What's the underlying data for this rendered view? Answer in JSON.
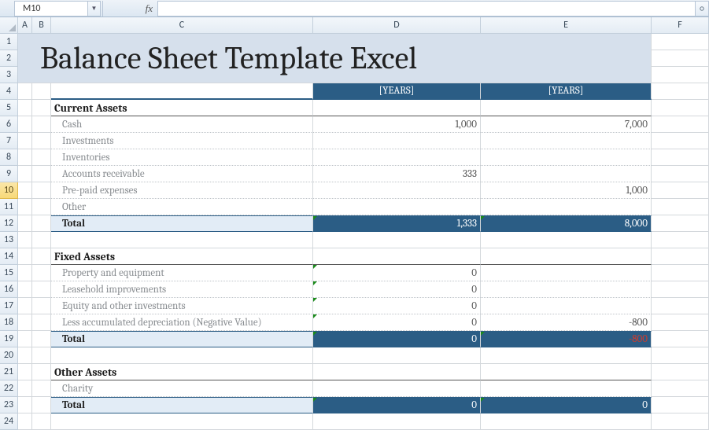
{
  "formula_bar": {
    "cell_ref": "M10",
    "fx_label": "fx",
    "formula": ""
  },
  "columns": [
    "A",
    "B",
    "C",
    "D",
    "E",
    "F"
  ],
  "title": "Balance Sheet Template Excel",
  "years_header": {
    "label_c": "",
    "col_d": "[YEARS]",
    "col_e": "[YEARS]"
  },
  "sections": {
    "current_assets": {
      "heading": "Current Assets",
      "items": [
        {
          "label": "Cash",
          "d": "1,000",
          "e": "7,000"
        },
        {
          "label": "Investments",
          "d": "",
          "e": ""
        },
        {
          "label": "Inventories",
          "d": "",
          "e": ""
        },
        {
          "label": "Accounts receivable",
          "d": "333",
          "e": ""
        },
        {
          "label": "Pre-paid expenses",
          "d": "",
          "e": "1,000"
        },
        {
          "label": "Other",
          "d": "",
          "e": ""
        }
      ],
      "total": {
        "label": "Total",
        "d": "1,333",
        "e": "8,000"
      }
    },
    "fixed_assets": {
      "heading": "Fixed Assets",
      "items": [
        {
          "label": "Property and equipment",
          "d": "0",
          "e": ""
        },
        {
          "label": "Leasehold improvements",
          "d": "0",
          "e": ""
        },
        {
          "label": "Equity and other investments",
          "d": "0",
          "e": ""
        },
        {
          "label": "Less accumulated depreciation (Negative Value)",
          "d": "0",
          "e": "-800"
        }
      ],
      "total": {
        "label": "Total",
        "d": "0",
        "e": "-800"
      }
    },
    "other_assets": {
      "heading": "Other Assets",
      "items": [
        {
          "label": "Charity",
          "d": "",
          "e": ""
        }
      ],
      "total": {
        "label": "Total",
        "d": "0",
        "e": "0"
      }
    }
  },
  "chart_data": {
    "type": "table",
    "title": "Balance Sheet Template Excel",
    "columns": [
      "[YEARS]",
      "[YEARS]"
    ],
    "rows": [
      {
        "section": "Current Assets",
        "item": "Cash",
        "values": [
          1000,
          7000
        ]
      },
      {
        "section": "Current Assets",
        "item": "Investments",
        "values": [
          null,
          null
        ]
      },
      {
        "section": "Current Assets",
        "item": "Inventories",
        "values": [
          null,
          null
        ]
      },
      {
        "section": "Current Assets",
        "item": "Accounts receivable",
        "values": [
          333,
          null
        ]
      },
      {
        "section": "Current Assets",
        "item": "Pre-paid expenses",
        "values": [
          null,
          1000
        ]
      },
      {
        "section": "Current Assets",
        "item": "Other",
        "values": [
          null,
          null
        ]
      },
      {
        "section": "Current Assets",
        "item": "Total",
        "values": [
          1333,
          8000
        ]
      },
      {
        "section": "Fixed Assets",
        "item": "Property and equipment",
        "values": [
          0,
          null
        ]
      },
      {
        "section": "Fixed Assets",
        "item": "Leasehold improvements",
        "values": [
          0,
          null
        ]
      },
      {
        "section": "Fixed Assets",
        "item": "Equity and other investments",
        "values": [
          0,
          null
        ]
      },
      {
        "section": "Fixed Assets",
        "item": "Less accumulated depreciation (Negative Value)",
        "values": [
          0,
          -800
        ]
      },
      {
        "section": "Fixed Assets",
        "item": "Total",
        "values": [
          0,
          -800
        ]
      },
      {
        "section": "Other Assets",
        "item": "Charity",
        "values": [
          null,
          null
        ]
      },
      {
        "section": "Other Assets",
        "item": "Total",
        "values": [
          0,
          0
        ]
      }
    ]
  }
}
